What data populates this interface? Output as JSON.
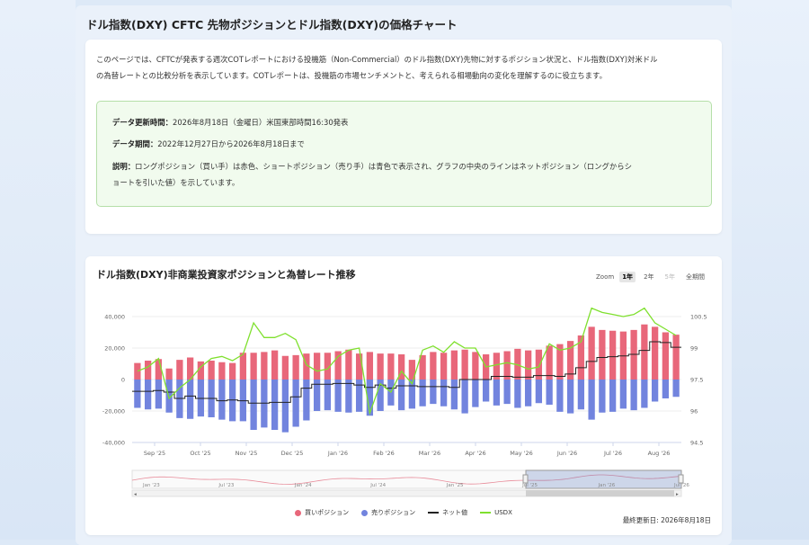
{
  "page": {
    "title": "ドル指数(DXY) CFTC 先物ポジションとドル指数(DXY)の価格チャート",
    "intro_line1": "このページでは、CFTCが発表する週次COTレポートにおける投機筋（Non-Commercial）のドル指数(DXY)先物に対するポジション状況と、ドル指数(DXY)対米ドル",
    "intro_line2": "の為替レートとの比較分析を表示しています。COTレポートは、投機筋の市場センチメントと、考えられる相場動向の変化を理解するのに役立ちます。"
  },
  "info": {
    "update_label": "データ更新時間：",
    "update_value": "2026年8月18日（金曜日）米国東部時間16:30発表",
    "period_label": "データ期間：",
    "period_value": "2022年12月27日から2026年8月18日まで",
    "desc_label": "説明：",
    "desc_line1": "ロングポジション（買い手）は赤色、ショートポジション（売り手）は青色で表示され、グラフの中央のラインはネットポジション（ロングからシ",
    "desc_line2": "ョートを引いた値）を示しています。"
  },
  "chart_header": {
    "title": "ドル指数(DXY)非商業投資家ポジションと為替レート推移",
    "zoom_label": "Zoom",
    "zoom_buttons": [
      "1年",
      "2年",
      "5年",
      "全期間"
    ]
  },
  "colors": {
    "long": "#e8677a",
    "short": "#7284de",
    "net": "#222222",
    "usdx": "#7fe02e"
  },
  "chart_data": {
    "type": "bar",
    "x_labels": [
      "Sep '25",
      "Oct '25",
      "Nov '25",
      "Dec '25",
      "Jan '26",
      "Feb '26",
      "Mar '26",
      "Apr '26",
      "May '26",
      "Jun '26",
      "Jul '26",
      "Aug '26"
    ],
    "left_axis_ticks": [
      "40,000",
      "20,000",
      "0",
      "-20,000",
      "-40,000"
    ],
    "right_axis_ticks": [
      "100.5",
      "99",
      "97.5",
      "96",
      "94.5"
    ],
    "ylim_left": [
      -40000,
      40000
    ],
    "ylim_right": [
      94.5,
      100.5
    ],
    "series": [
      {
        "name": "買いポジション",
        "values": [
          10500,
          12000,
          13000,
          7000,
          12500,
          14000,
          11500,
          12000,
          11000,
          10500,
          17000,
          17000,
          17500,
          18500,
          15000,
          15500,
          16500,
          17000,
          17000,
          18000,
          19000,
          16500,
          17500,
          16500,
          16500,
          16000,
          12500,
          15500,
          17500,
          17000,
          18500,
          19000,
          17500,
          16000,
          17000,
          18000,
          19500,
          18500,
          19000,
          21500,
          22500,
          24500,
          28000,
          33500,
          31500,
          31000,
          30500,
          31500,
          35000,
          33500,
          30000,
          28500
        ]
      },
      {
        "name": "売りポジション",
        "values": [
          -18000,
          -19000,
          -18500,
          -21000,
          -24500,
          -25000,
          -23500,
          -24000,
          -25500,
          -26500,
          -26500,
          -32000,
          -30500,
          -32000,
          -33500,
          -30000,
          -26000,
          -20000,
          -19500,
          -20500,
          -21000,
          -20500,
          -23000,
          -20000,
          -16500,
          -19500,
          -18500,
          -17000,
          -15500,
          -17000,
          -19000,
          -21500,
          -17500,
          -14000,
          -16500,
          -15500,
          -18000,
          -17000,
          -15000,
          -16000,
          -20500,
          -21500,
          -19000,
          -25500,
          -21000,
          -20500,
          -18500,
          -19500,
          -18000,
          -14000,
          -12000,
          -11000
        ]
      },
      {
        "name": "ネット値",
        "values": [
          -7500,
          -7500,
          -7000,
          -8000,
          -12000,
          -10500,
          -12000,
          -12000,
          -13500,
          -13000,
          -13500,
          -15000,
          -15000,
          -14500,
          -14500,
          -11000,
          -5500,
          -3000,
          -3000,
          -2500,
          -2500,
          -3500,
          -5000,
          -3500,
          -5500,
          -4000,
          -4000,
          -4500,
          -4500,
          -4500,
          -5000,
          0,
          0,
          0,
          2000,
          2000,
          1500,
          1500,
          2500,
          2500,
          2000,
          3500,
          7500,
          11500,
          14000,
          14500,
          15000,
          16000,
          18500,
          24000,
          23500,
          20500
        ]
      },
      {
        "name": "USDX",
        "values": [
          97.9,
          98.1,
          98.5,
          96.6,
          97.1,
          97.5,
          98.1,
          98.5,
          98.6,
          98.4,
          98.7,
          100.2,
          99.5,
          99.5,
          99.7,
          99.4,
          98.2,
          97.9,
          98.0,
          98.6,
          98.9,
          99.0,
          95.9,
          97.3,
          96.9,
          97.9,
          97.3,
          98.9,
          99.1,
          98.8,
          99.3,
          99.0,
          99.0,
          98.1,
          98.2,
          98.3,
          98.2,
          98.0,
          98.1,
          99.2,
          98.9,
          99.0,
          99.3,
          100.9,
          100.7,
          100.6,
          100.5,
          100.6,
          100.9,
          100.2,
          99.9,
          99.6
        ]
      }
    ],
    "navigator_labels": [
      "Jan '23",
      "Jul '23",
      "Jan '24",
      "Jul '24",
      "Jan '25",
      "Jul '25",
      "Jan '26",
      "Jul '26"
    ]
  },
  "legend": {
    "long": "買いポジション",
    "short": "売りポジション",
    "net": "ネット値",
    "usdx": "USDX"
  },
  "footer": {
    "updated": "最終更新日: 2026年8月18日"
  }
}
